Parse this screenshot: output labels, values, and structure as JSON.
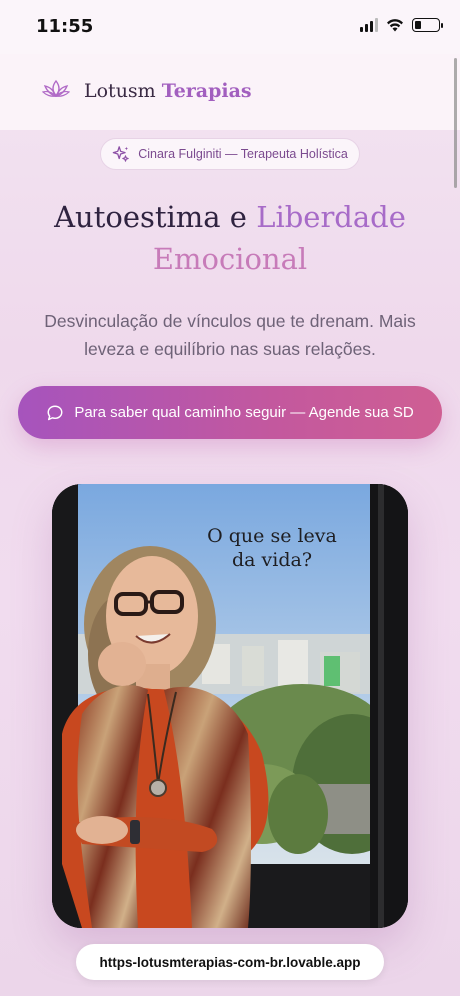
{
  "status_bar": {
    "time": "11:55"
  },
  "header": {
    "brand_main": "Lotusm ",
    "brand_accent": "Terapias",
    "logo_icon": "lotus-icon"
  },
  "badge": {
    "text": "Cinara Fulginiti — Terapeuta Holística",
    "icon": "sparkles-icon"
  },
  "hero": {
    "title_part1": "Autoestima e ",
    "title_part2": "Liberdade",
    "title_part3": "Emocional",
    "subtitle": "Desvinculação de vínculos que te drenam. Mais leveza e equilíbrio nas suas relações."
  },
  "cta": {
    "label": "Para saber qual caminho seguir — Agende sua SD",
    "icon": "chat-bubble-icon"
  },
  "photo": {
    "caption": "O que se leva da vida?"
  },
  "browser": {
    "url": "https-lotusmterapias-com-br.lovable.app"
  },
  "colors": {
    "accent": "#a25fbf",
    "cta_start": "#a654bd",
    "cta_end": "#cf5f93"
  }
}
